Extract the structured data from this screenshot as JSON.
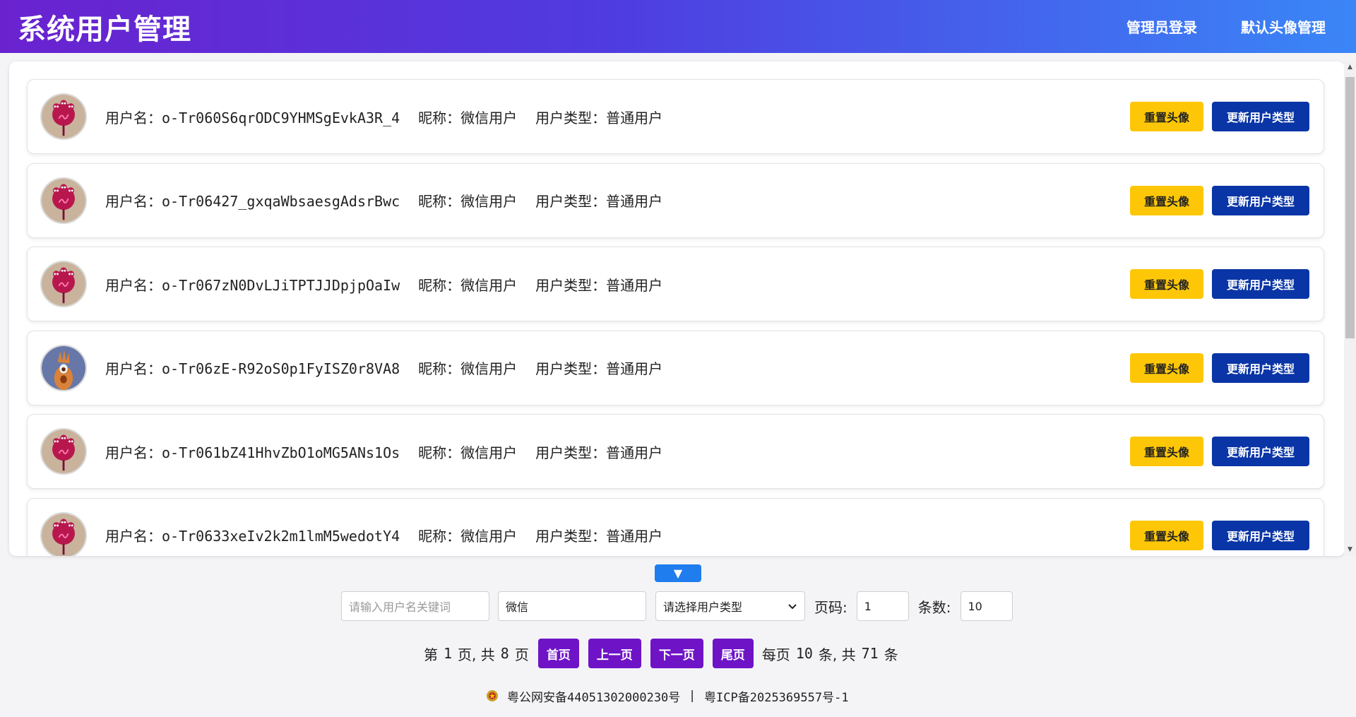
{
  "header": {
    "title": "系统用户管理",
    "nav": [
      "管理员登录",
      "默认头像管理"
    ]
  },
  "labels": {
    "username": "用户名：",
    "nickname": "昵称：",
    "usertype": "用户类型："
  },
  "users": [
    {
      "username": "o-Tr060S6qrODC9YHMSgEvkA3R_4",
      "nickname": "微信用户",
      "type": "普通用户",
      "avatar": "red-flower"
    },
    {
      "username": "o-Tr06427_gxqaWbsaesgAdsrBwc",
      "nickname": "微信用户",
      "type": "普通用户",
      "avatar": "red-flower"
    },
    {
      "username": "o-Tr067zN0DvLJiTPTJJDpjpOaIw",
      "nickname": "微信用户",
      "type": "普通用户",
      "avatar": "red-flower"
    },
    {
      "username": "o-Tr06zE-R92oS0p1FyISZ0r8VA8",
      "nickname": "微信用户",
      "type": "普通用户",
      "avatar": "orange-creature"
    },
    {
      "username": "o-Tr061bZ41HhvZbO1oMG5ANs1Os",
      "nickname": "微信用户",
      "type": "普通用户",
      "avatar": "red-flower"
    },
    {
      "username": "o-Tr0633xeIv2k2m1lmM5wedotY4",
      "nickname": "微信用户",
      "type": "普通用户",
      "avatar": "red-flower"
    }
  ],
  "actions": {
    "reset_avatar": "重置头像",
    "update_type": "更新用户类型"
  },
  "expand_toggle": "▼",
  "filters": {
    "keyword_placeholder": "请输入用户名关键词",
    "nickname_value": "微信",
    "type_select": "请选择用户类型",
    "page_label": "页码:",
    "page_value": "1",
    "size_label": "条数:",
    "size_value": "10"
  },
  "pager": {
    "prefix": "第",
    "current": "1",
    "mid": "页, 共",
    "total_pages": "8",
    "suffix": "页",
    "first": "首页",
    "prev": "上一页",
    "next": "下一页",
    "last": "尾页",
    "per_prefix": "每页",
    "per": "10",
    "per_mid": "条, 共",
    "total": "71",
    "per_suffix": "条"
  },
  "footer": {
    "police": "粤公网安备44051302000230号",
    "separator": "|",
    "icp": "粤ICP备2025369557号-1"
  },
  "colors": {
    "header_start": "#6a22cf",
    "header_end": "#3a86f7",
    "reset_button": "#fdc707",
    "type_button": "#0a35a6",
    "pager_button": "#6e14c6",
    "expand_button": "#1f7dee"
  }
}
